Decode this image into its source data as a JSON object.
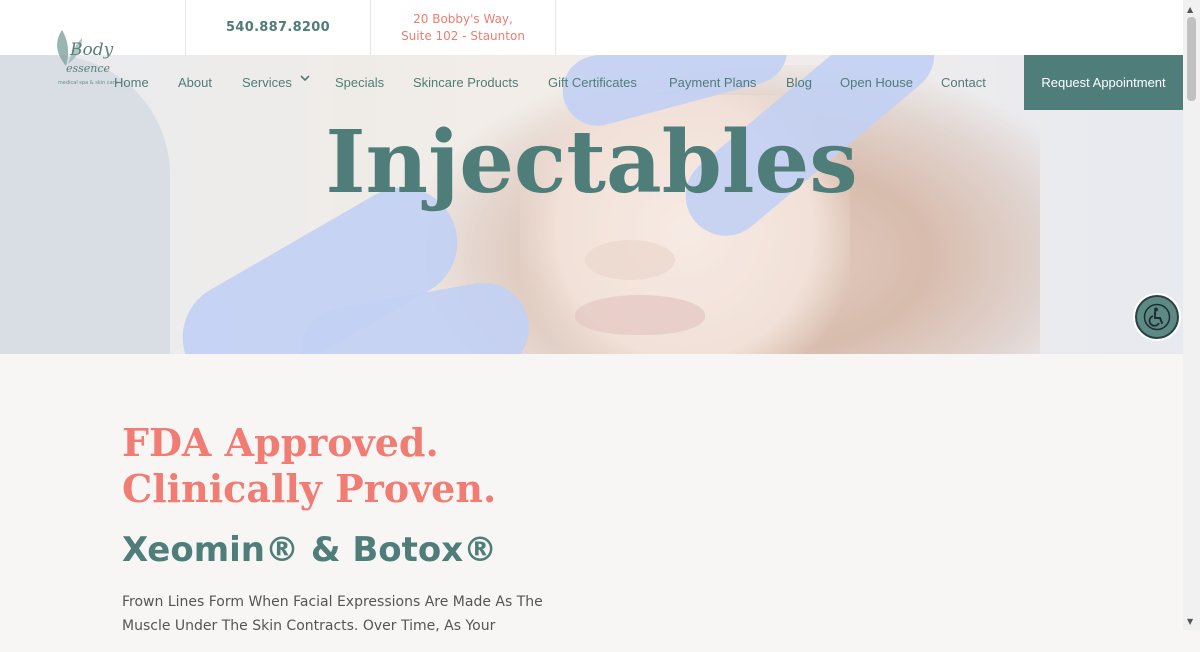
{
  "header": {
    "phone": "540.887.8200",
    "address_line1": "20 Bobby's Way,",
    "address_line2": "Suite 102 - Staunton",
    "logo": {
      "line1": "Body",
      "line2": "essence",
      "tagline": "medical spa & skin care"
    }
  },
  "nav": {
    "items": [
      {
        "label": "Home"
      },
      {
        "label": "About"
      },
      {
        "label": "Services"
      },
      {
        "label": "Specials"
      },
      {
        "label": "Skincare Products"
      },
      {
        "label": "Gift Certificates"
      },
      {
        "label": "Payment Plans"
      },
      {
        "label": "Blog"
      },
      {
        "label": "Open House"
      },
      {
        "label": "Contact"
      }
    ],
    "cta": "Request Appointment"
  },
  "hero": {
    "title": "Injectables"
  },
  "main": {
    "headline_line1": "FDA Approved.",
    "headline_line2": "Clinically Proven.",
    "subheadline": "Xeomin® & Botox®",
    "body": "Frown Lines Form When Facial Expressions Are Made As The Muscle Under The Skin Contracts. Over Time, As Your"
  },
  "colors": {
    "brand_teal": "#4f7d79",
    "accent_coral": "#f07c73",
    "page_bg": "#f8f6f4"
  },
  "icons": {
    "services_dropdown": "chevron-down-icon",
    "accessibility": "accessibility-icon",
    "logo_leaf": "leaf-icon"
  }
}
